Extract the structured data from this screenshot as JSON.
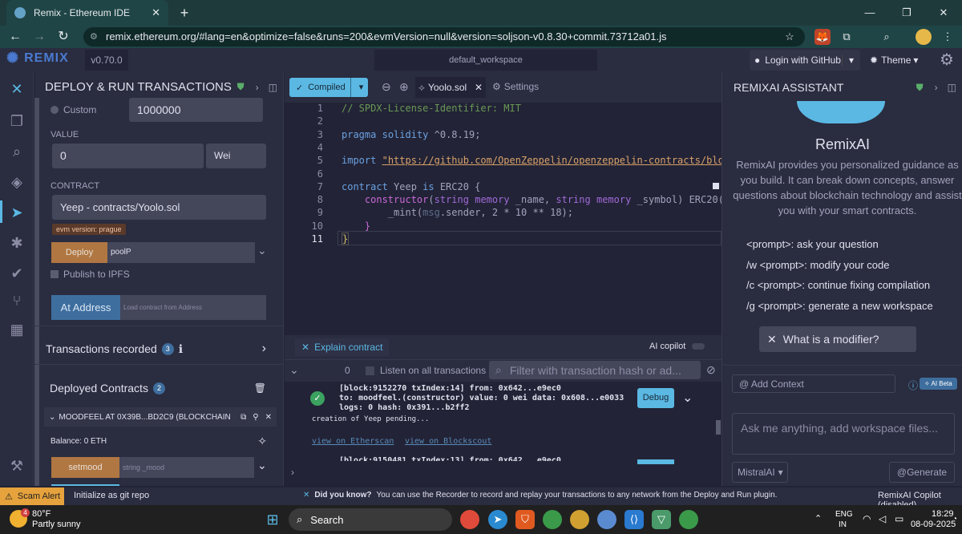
{
  "browser": {
    "tab_title": "Remix - Ethereum IDE",
    "tab_close": "✕",
    "new_tab": "+",
    "url": "remix.ethereum.org/#lang=en&optimize=false&runs=200&evmVersion=null&version=soljson-v0.8.30+commit.73712a01.js"
  },
  "header": {
    "logo": "REMIX",
    "version": "v0.70.0",
    "workspace": "default_workspace",
    "github": "Login with GitHub",
    "theme": "Theme"
  },
  "left_panel": {
    "title": "DEPLOY & RUN TRANSACTIONS",
    "custom_label": "Custom",
    "gas_value": "1000000",
    "value_label": "VALUE",
    "value_amount": "0",
    "value_unit": "Wei",
    "contract_label": "CONTRACT",
    "contract_selected": "Yeep - contracts/Yoolo.sol",
    "evm_badge": "evm version: prague",
    "deploy_label": "Deploy",
    "deploy_input_value": "poolP",
    "publish_ipfs": "Publish to IPFS",
    "at_address": "At Address",
    "at_address_placeholder": "Load contract from Address",
    "transactions_recorded": "Transactions recorded",
    "transactions_count": "3",
    "deployed_contracts": "Deployed Contracts",
    "deployed_count": "2",
    "contract_instance": "MOODFEEL AT 0X39B...BD2C9 (BLOCKCHAIN",
    "balance": "Balance: 0 ETH",
    "setmood_label": "setmood",
    "setmood_placeholder": "string _mood"
  },
  "editor": {
    "compiled_label": "Compiled",
    "file_tab": "Yoolo.sol",
    "settings_tab": "Settings",
    "lines": [
      "1",
      "2",
      "3",
      "4",
      "5",
      "6",
      "7",
      "8",
      "9",
      "10",
      "11"
    ]
  },
  "terminal": {
    "explain": "Explain contract",
    "ai_copilot": "AI copilot",
    "counter": "0",
    "listen": "Listen on all transactions",
    "filter_placeholder": "Filter with transaction hash or ad...",
    "tx_line1": "[block:9152270 txIndex:14]  from: 0x642...e9ec0",
    "tx_line2": "to: moodfeel.(constructor) value: 0 wei data: 0x608...e0033",
    "tx_line3": "logs: 0 hash: 0x391...b2ff2",
    "debug": "Debug",
    "pending": "creation of Yeep pending...",
    "etherscan": "view on Etherscan",
    "blockscout": "view on Blockscout",
    "tx_line4": "[block:9150481 txIndex:13]  from: 0x642...e9ec0"
  },
  "right_panel": {
    "title": "REMIXAI ASSISTANT",
    "heading": "RemixAI",
    "intro": "RemixAI provides you personalized guidance as you build. It can break down concepts, answer questions about blockchain technology and assist you with your smart contracts.",
    "cmd1": "<prompt>:  ask your question",
    "cmd2": "/w <prompt>:  modify your code",
    "cmd3": "/c <prompt>:  continue fixing compilation",
    "cmd4": "/g <prompt>:  generate a new workspace",
    "suggestion": "What is a modifier?",
    "add_context": "@ Add Context",
    "ai_beta": "AI Beta",
    "ask_placeholder": "Ask me anything, add workspace files...",
    "model": "MistralAI",
    "generate": "@Generate"
  },
  "status_bar": {
    "scam": "Scam Alert",
    "git": "Initialize as git repo",
    "tip_title": "Did you know?",
    "tip": "You can use the Recorder to record and replay your transactions to any network from the Deploy and Run plugin.",
    "copilot": "RemixAI Copilot (disabled)"
  },
  "taskbar": {
    "weather_temp": "80°F",
    "weather_desc": "Partly sunny",
    "weather_badge": "4",
    "search": "Search",
    "lang1": "ENG",
    "lang2": "IN",
    "time": "18:29",
    "date": "08-09-2025"
  }
}
